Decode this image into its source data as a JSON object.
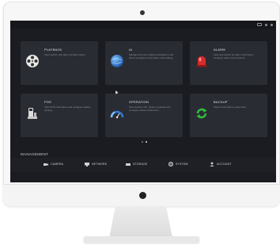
{
  "colors": {
    "screen_bg": "#1a1c21",
    "tile_bg": "#2a2c33",
    "alarm_red": "#d62b2b",
    "backup_green": "#2fbf3a",
    "ai_blue": "#2f7bd6"
  },
  "tiles": [
    {
      "title": "PLAYBACK",
      "desc": "View search, and play recorded videos.",
      "icon": "film-reel-icon"
    },
    {
      "title": "AI",
      "desc": "Manage and view artificial intelligence and faces recognition information and settings.",
      "icon": "globe-icon"
    },
    {
      "title": "ALARM",
      "desc": "View and search for alarm information, configure alarm event actions.",
      "icon": "alarm-siren-icon"
    },
    {
      "title": "POS",
      "desc": "View POS information and configure related settings.",
      "icon": "pos-terminal-icon"
    },
    {
      "title": "OPERATION",
      "desc": "View System info, System upgrade and configure device parameters.",
      "icon": "speedometer-icon"
    },
    {
      "title": "BACKUP",
      "desc": "Search and back up video files.",
      "icon": "backup-arrows-icon"
    }
  ],
  "pager": {
    "pages": 2,
    "active": 2
  },
  "management": {
    "label": "MANAGEMENT",
    "items": [
      {
        "label": "CAMERA",
        "icon": "camera-icon"
      },
      {
        "label": "NETWORK",
        "icon": "network-icon"
      },
      {
        "label": "STORAGE",
        "icon": "storage-icon"
      },
      {
        "label": "SYSTEM",
        "icon": "gear-icon"
      },
      {
        "label": "ACCOUNT",
        "icon": "user-icon"
      }
    ]
  }
}
